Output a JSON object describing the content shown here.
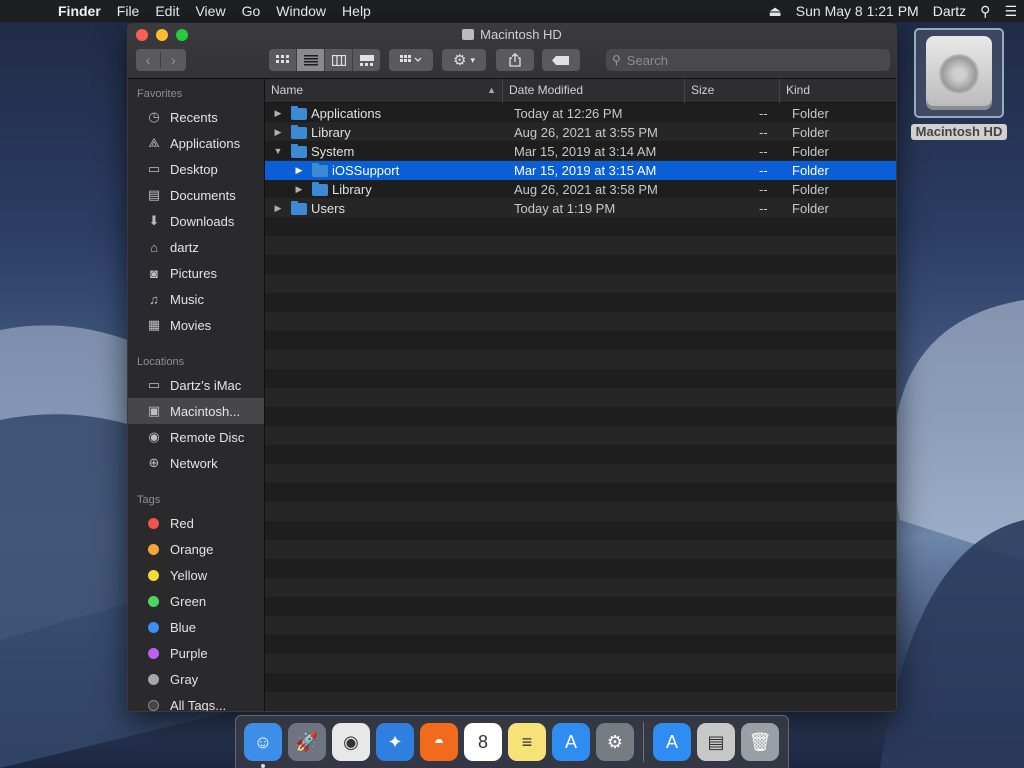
{
  "menubar": {
    "app_name": "Finder",
    "items": [
      "File",
      "Edit",
      "View",
      "Go",
      "Window",
      "Help"
    ],
    "clock": "Sun May 8  1:21 PM",
    "user": "Dartz"
  },
  "window": {
    "title": "Macintosh HD",
    "search_placeholder": "Search"
  },
  "sidebar": {
    "favorites_header": "Favorites",
    "favorites": [
      {
        "label": "Recents",
        "icon": "clock-icon"
      },
      {
        "label": "Applications",
        "icon": "applications-icon"
      },
      {
        "label": "Desktop",
        "icon": "desktop-icon"
      },
      {
        "label": "Documents",
        "icon": "document-icon"
      },
      {
        "label": "Downloads",
        "icon": "download-icon"
      },
      {
        "label": "dartz",
        "icon": "home-icon"
      },
      {
        "label": "Pictures",
        "icon": "camera-icon"
      },
      {
        "label": "Music",
        "icon": "music-icon"
      },
      {
        "label": "Movies",
        "icon": "film-icon"
      }
    ],
    "locations_header": "Locations",
    "locations": [
      {
        "label": "Dartz’s iMac",
        "icon": "computer-icon"
      },
      {
        "label": "Macintosh...",
        "icon": "hard-drive-icon"
      },
      {
        "label": "Remote Disc",
        "icon": "disc-icon"
      },
      {
        "label": "Network",
        "icon": "network-icon"
      }
    ],
    "tags_header": "Tags",
    "tags": [
      {
        "label": "Red",
        "color": "#f4524d"
      },
      {
        "label": "Orange",
        "color": "#f6a33b"
      },
      {
        "label": "Yellow",
        "color": "#f8d73a"
      },
      {
        "label": "Green",
        "color": "#4fd45d"
      },
      {
        "label": "Blue",
        "color": "#3b8ff6"
      },
      {
        "label": "Purple",
        "color": "#bf5ef2"
      },
      {
        "label": "Gray",
        "color": "#a6a6a6"
      },
      {
        "label": "All Tags...",
        "color": ""
      }
    ]
  },
  "columns": {
    "name": "Name",
    "date": "Date Modified",
    "size": "Size",
    "kind": "Kind"
  },
  "rows": [
    {
      "name": "Applications",
      "date": "Today at 12:26 PM",
      "size": "--",
      "kind": "Folder",
      "level": 0,
      "expanded": false,
      "selected": false
    },
    {
      "name": "Library",
      "date": "Aug 26, 2021 at 3:55 PM",
      "size": "--",
      "kind": "Folder",
      "level": 0,
      "expanded": false,
      "selected": false
    },
    {
      "name": "System",
      "date": "Mar 15, 2019 at 3:14 AM",
      "size": "--",
      "kind": "Folder",
      "level": 0,
      "expanded": true,
      "selected": false
    },
    {
      "name": "iOSSupport",
      "date": "Mar 15, 2019 at 3:15 AM",
      "size": "--",
      "kind": "Folder",
      "level": 1,
      "expanded": false,
      "selected": true
    },
    {
      "name": "Library",
      "date": "Aug 26, 2021 at 3:58 PM",
      "size": "--",
      "kind": "Folder",
      "level": 1,
      "expanded": false,
      "selected": false
    },
    {
      "name": "Users",
      "date": "Today at 1:19 PM",
      "size": "--",
      "kind": "Folder",
      "level": 0,
      "expanded": false,
      "selected": false
    }
  ],
  "desktop": {
    "icon_label": "Macintosh HD"
  },
  "dock": {
    "apps": [
      {
        "name": "finder-icon",
        "bg": "#3d8ee8",
        "glyph": "☺"
      },
      {
        "name": "launchpad-icon",
        "bg": "#6e7480",
        "glyph": "🚀"
      },
      {
        "name": "chrome-icon",
        "bg": "#e8e8e8",
        "glyph": "◉"
      },
      {
        "name": "safari-icon",
        "bg": "#2f7fe0",
        "glyph": "✦"
      },
      {
        "name": "firefox-icon",
        "bg": "#f26a1b",
        "glyph": "◓"
      },
      {
        "name": "calendar-icon",
        "bg": "#ffffff",
        "glyph": "8"
      },
      {
        "name": "notes-icon",
        "bg": "#f7e27a",
        "glyph": "≡"
      },
      {
        "name": "app-store-icon",
        "bg": "#2f8cf0",
        "glyph": "A"
      },
      {
        "name": "system-preferences-icon",
        "bg": "#777b82",
        "glyph": "⚙"
      },
      {
        "name": "sep"
      },
      {
        "name": "applications-folder-icon",
        "bg": "#2f8cf0",
        "glyph": "A"
      },
      {
        "name": "documents-stack-icon",
        "bg": "#c8c8c8",
        "glyph": "▤"
      },
      {
        "name": "trash-icon",
        "bg": "#9a9ea5",
        "glyph": "🗑"
      }
    ]
  }
}
